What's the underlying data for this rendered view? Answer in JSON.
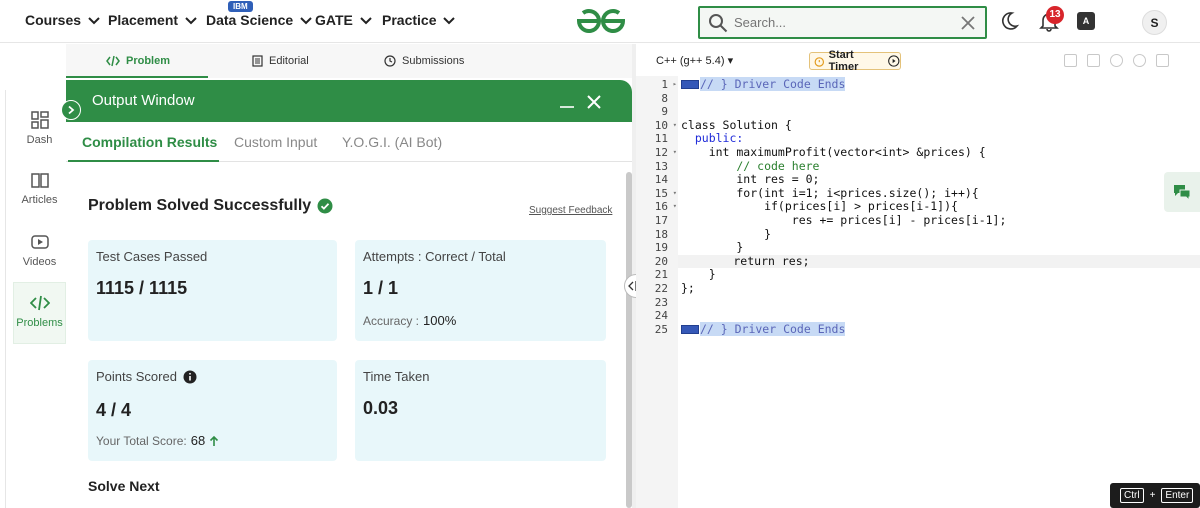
{
  "nav": {
    "items": [
      {
        "label": "Courses"
      },
      {
        "label": "Placement"
      },
      {
        "label": "Data Science"
      },
      {
        "label": "GATE"
      },
      {
        "label": "Practice"
      }
    ],
    "ibm_badge": "IBM",
    "search_placeholder": "Search...",
    "notifications_count": "13",
    "avatar_letter": "S",
    "translate_glyph": "A"
  },
  "sidebar": {
    "items": [
      {
        "label": "Dash",
        "icon": "dashboard-icon"
      },
      {
        "label": "Articles",
        "icon": "book-icon"
      },
      {
        "label": "Videos",
        "icon": "play-icon"
      },
      {
        "label": "Problems",
        "icon": "code-icon",
        "active": true
      }
    ]
  },
  "problem_tabs": [
    {
      "label": "Problem",
      "icon": "code-icon",
      "active": true
    },
    {
      "label": "Editorial",
      "icon": "document-icon"
    },
    {
      "label": "Submissions",
      "icon": "clock-icon"
    }
  ],
  "output": {
    "title": "Output Window",
    "tabs": [
      {
        "label": "Compilation Results",
        "active": true
      },
      {
        "label": "Custom Input"
      },
      {
        "label": "Y.O.G.I. (AI Bot)"
      }
    ],
    "status": "Problem Solved Successfully",
    "feedback_link": "Suggest Feedback",
    "cards": {
      "test_cases": {
        "label": "Test Cases Passed",
        "value": "1115 / 1115"
      },
      "attempts": {
        "label": "Attempts : Correct / Total",
        "value": "1 / 1",
        "sub_label": "Accuracy :",
        "sub_value": "100%"
      },
      "points": {
        "label": "Points Scored",
        "value": "4 / 4",
        "sub_label": "Your Total Score:",
        "sub_value": "68"
      },
      "time": {
        "label": "Time Taken",
        "value": "0.03"
      }
    },
    "solve_next": "Solve Next"
  },
  "editor": {
    "language": "C++ (g++ 5.4)",
    "timer_label": "Start Timer",
    "line_numbers": [
      "1",
      "8",
      "9",
      "10",
      "11",
      "12",
      "13",
      "14",
      "15",
      "16",
      "17",
      "18",
      "19",
      "20",
      "21",
      "22",
      "23",
      "24",
      "25"
    ],
    "lines": [
      "// } Driver Code Ends",
      "",
      "",
      "class Solution {",
      "  public:",
      "    int maximumProfit(vector<int> &prices) {",
      "        // code here",
      "        int res = 0;",
      "        for(int i=1; i<prices.size(); i++){",
      "            if(prices[i] > prices[i-1]){",
      "                res += prices[i] - prices[i-1];",
      "            }",
      "        }",
      "        return res;",
      "    }",
      "};",
      "",
      "",
      "// } Driver Code Ends"
    ]
  },
  "shortcut": {
    "key1": "Ctrl",
    "plus": "+",
    "key2": "Enter"
  },
  "colors": {
    "brand_green": "#2f8d46",
    "card_bg": "#e8f7fa",
    "badge_red": "#d8252b"
  }
}
